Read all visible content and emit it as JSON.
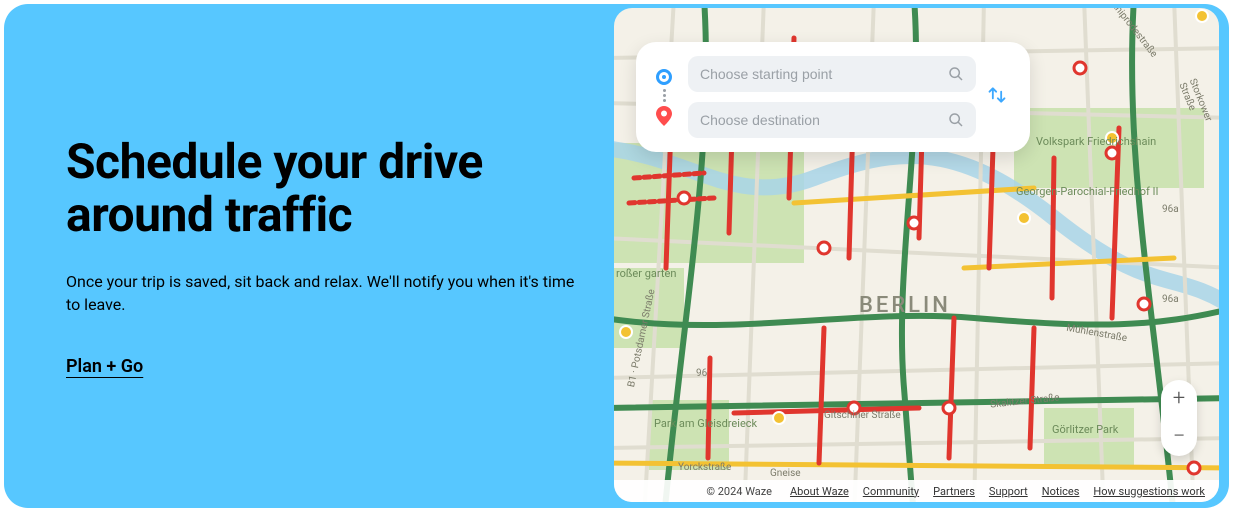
{
  "hero": {
    "heading": "Schedule your drive around traffic",
    "subheading": "Once your trip is saved, sit back and relax. We'll notify you when it's time to leave.",
    "cta_label": "Plan + Go"
  },
  "search": {
    "start_placeholder": "Choose starting point",
    "dest_placeholder": "Choose destination"
  },
  "map": {
    "city_label": "BERLIN",
    "parks": {
      "vp_friedrichshain": "Volkspark\nFriedrichshain",
      "georgen": "Georgen-Parochial-Friedhof\nII",
      "gleisdreieck": "Park am\nGleisdreieck",
      "tiergarten": "roßer\ngarten",
      "gorlitzer": "Görlitzer\nPark"
    },
    "roads": {
      "kniprode": "Kniprodestraße",
      "storkower": "Storkower Straße",
      "r96a_1": "96a",
      "r96a_2": "96a",
      "muhlen": "Mühlenstraße",
      "skalitzer": "Skalitzer Straße",
      "gitschiner": "Gitschiner Straße",
      "yorck": "Yorckstraße",
      "gneise": "Gneise",
      "potsdamer": "B1 · Potsdamer Straße",
      "r96": "96"
    }
  },
  "zoom": {
    "in": "+",
    "out": "−"
  },
  "attribution": {
    "copyright": "© 2024 Waze",
    "links": [
      "About Waze",
      "Community",
      "Partners",
      "Support",
      "Notices",
      "How suggestions work"
    ]
  }
}
